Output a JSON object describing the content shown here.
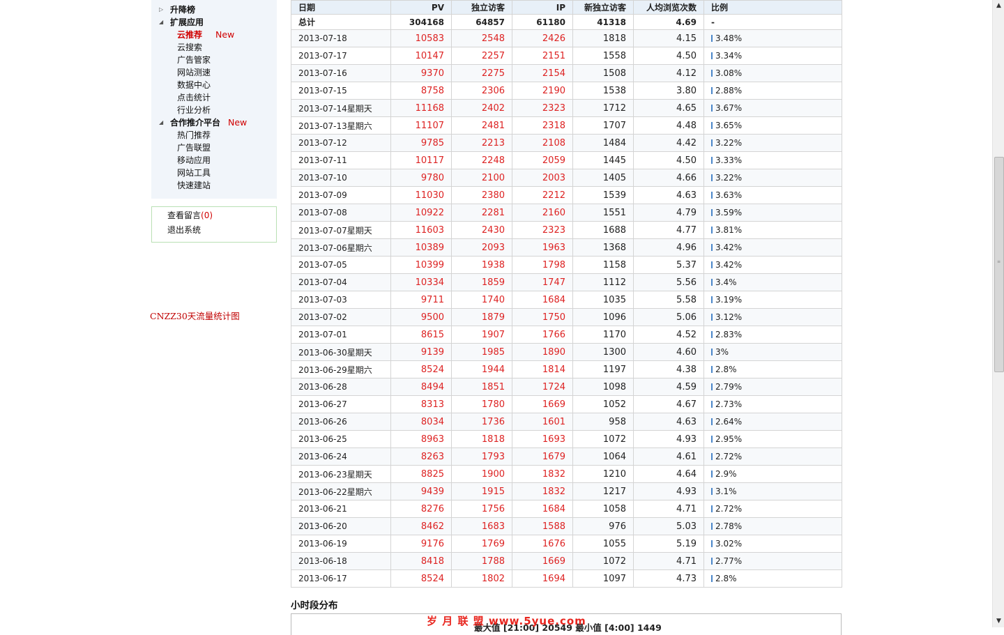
{
  "sidebar": {
    "items": [
      {
        "label": "升降榜",
        "level": 1,
        "expand": "▷"
      },
      {
        "label": "扩展应用",
        "level": 1,
        "expand": "◢"
      },
      {
        "label": "云推荐",
        "level": 2,
        "active": true,
        "badge": "New"
      },
      {
        "label": "云搜索",
        "level": 2
      },
      {
        "label": "广告管家",
        "level": 2
      },
      {
        "label": "网站测速",
        "level": 2
      },
      {
        "label": "数据中心",
        "level": 2
      },
      {
        "label": "点击统计",
        "level": 2
      },
      {
        "label": "行业分析",
        "level": 2
      },
      {
        "label": "合作推介平台",
        "level": 1,
        "expand": "◢",
        "badge": "New"
      },
      {
        "label": "热门推荐",
        "level": 2
      },
      {
        "label": "广告联盟",
        "level": 2
      },
      {
        "label": "移动应用",
        "level": 2
      },
      {
        "label": "网站工具",
        "level": 2
      },
      {
        "label": "快速建站",
        "level": 2
      }
    ],
    "messages_label": "查看留言",
    "messages_count": "(0)",
    "logout_label": "退出系统"
  },
  "cnzz_link": "CNZZ30天流量统计图",
  "table": {
    "headers": [
      "日期",
      "PV",
      "独立访客",
      "IP",
      "新独立访客",
      "人均浏览次数",
      "比例"
    ],
    "total": [
      "总计",
      "304168",
      "64857",
      "61180",
      "41318",
      "4.69",
      "-"
    ],
    "rows": [
      [
        "2013-07-18",
        "10583",
        "2548",
        "2426",
        "1818",
        "4.15",
        "3.48%"
      ],
      [
        "2013-07-17",
        "10147",
        "2257",
        "2151",
        "1558",
        "4.50",
        "3.34%"
      ],
      [
        "2013-07-16",
        "9370",
        "2275",
        "2154",
        "1508",
        "4.12",
        "3.08%"
      ],
      [
        "2013-07-15",
        "8758",
        "2306",
        "2190",
        "1538",
        "3.80",
        "2.88%"
      ],
      [
        "2013-07-14星期天",
        "11168",
        "2402",
        "2323",
        "1712",
        "4.65",
        "3.67%"
      ],
      [
        "2013-07-13星期六",
        "11107",
        "2481",
        "2318",
        "1707",
        "4.48",
        "3.65%"
      ],
      [
        "2013-07-12",
        "9785",
        "2213",
        "2108",
        "1484",
        "4.42",
        "3.22%"
      ],
      [
        "2013-07-11",
        "10117",
        "2248",
        "2059",
        "1445",
        "4.50",
        "3.33%"
      ],
      [
        "2013-07-10",
        "9780",
        "2100",
        "2003",
        "1405",
        "4.66",
        "3.22%"
      ],
      [
        "2013-07-09",
        "11030",
        "2380",
        "2212",
        "1539",
        "4.63",
        "3.63%"
      ],
      [
        "2013-07-08",
        "10922",
        "2281",
        "2160",
        "1551",
        "4.79",
        "3.59%"
      ],
      [
        "2013-07-07星期天",
        "11603",
        "2430",
        "2323",
        "1688",
        "4.77",
        "3.81%"
      ],
      [
        "2013-07-06星期六",
        "10389",
        "2093",
        "1963",
        "1368",
        "4.96",
        "3.42%"
      ],
      [
        "2013-07-05",
        "10399",
        "1938",
        "1798",
        "1158",
        "5.37",
        "3.42%"
      ],
      [
        "2013-07-04",
        "10334",
        "1859",
        "1747",
        "1112",
        "5.56",
        "3.4%"
      ],
      [
        "2013-07-03",
        "9711",
        "1740",
        "1684",
        "1035",
        "5.58",
        "3.19%"
      ],
      [
        "2013-07-02",
        "9500",
        "1879",
        "1750",
        "1096",
        "5.06",
        "3.12%"
      ],
      [
        "2013-07-01",
        "8615",
        "1907",
        "1766",
        "1170",
        "4.52",
        "2.83%"
      ],
      [
        "2013-06-30星期天",
        "9139",
        "1985",
        "1890",
        "1300",
        "4.60",
        "3%"
      ],
      [
        "2013-06-29星期六",
        "8524",
        "1944",
        "1814",
        "1197",
        "4.38",
        "2.8%"
      ],
      [
        "2013-06-28",
        "8494",
        "1851",
        "1724",
        "1098",
        "4.59",
        "2.79%"
      ],
      [
        "2013-06-27",
        "8313",
        "1780",
        "1669",
        "1052",
        "4.67",
        "2.73%"
      ],
      [
        "2013-06-26",
        "8034",
        "1736",
        "1601",
        "958",
        "4.63",
        "2.64%"
      ],
      [
        "2013-06-25",
        "8963",
        "1818",
        "1693",
        "1072",
        "4.93",
        "2.95%"
      ],
      [
        "2013-06-24",
        "8263",
        "1793",
        "1679",
        "1064",
        "4.61",
        "2.72%"
      ],
      [
        "2013-06-23星期天",
        "8825",
        "1900",
        "1832",
        "1210",
        "4.64",
        "2.9%"
      ],
      [
        "2013-06-22星期六",
        "9439",
        "1915",
        "1832",
        "1217",
        "4.93",
        "3.1%"
      ],
      [
        "2013-06-21",
        "8276",
        "1756",
        "1684",
        "1058",
        "4.71",
        "2.72%"
      ],
      [
        "2013-06-20",
        "8462",
        "1683",
        "1588",
        "976",
        "5.03",
        "2.78%"
      ],
      [
        "2013-06-19",
        "9176",
        "1769",
        "1676",
        "1055",
        "5.19",
        "3.02%"
      ],
      [
        "2013-06-18",
        "8418",
        "1788",
        "1669",
        "1072",
        "4.71",
        "2.77%"
      ],
      [
        "2013-06-17",
        "8524",
        "1802",
        "1694",
        "1097",
        "4.73",
        "2.8%"
      ]
    ]
  },
  "hour_section": {
    "title": "小时段分布",
    "watermark": "岁 月 联 盟 www.5yue.com",
    "summary": "最大值 [21:00] 20549   最小值 [4:00] 1449"
  },
  "colors": {
    "accent_red": "#d22222",
    "header_bg": "#e8f0f8",
    "sidebar_bg": "#f1f5fa"
  }
}
